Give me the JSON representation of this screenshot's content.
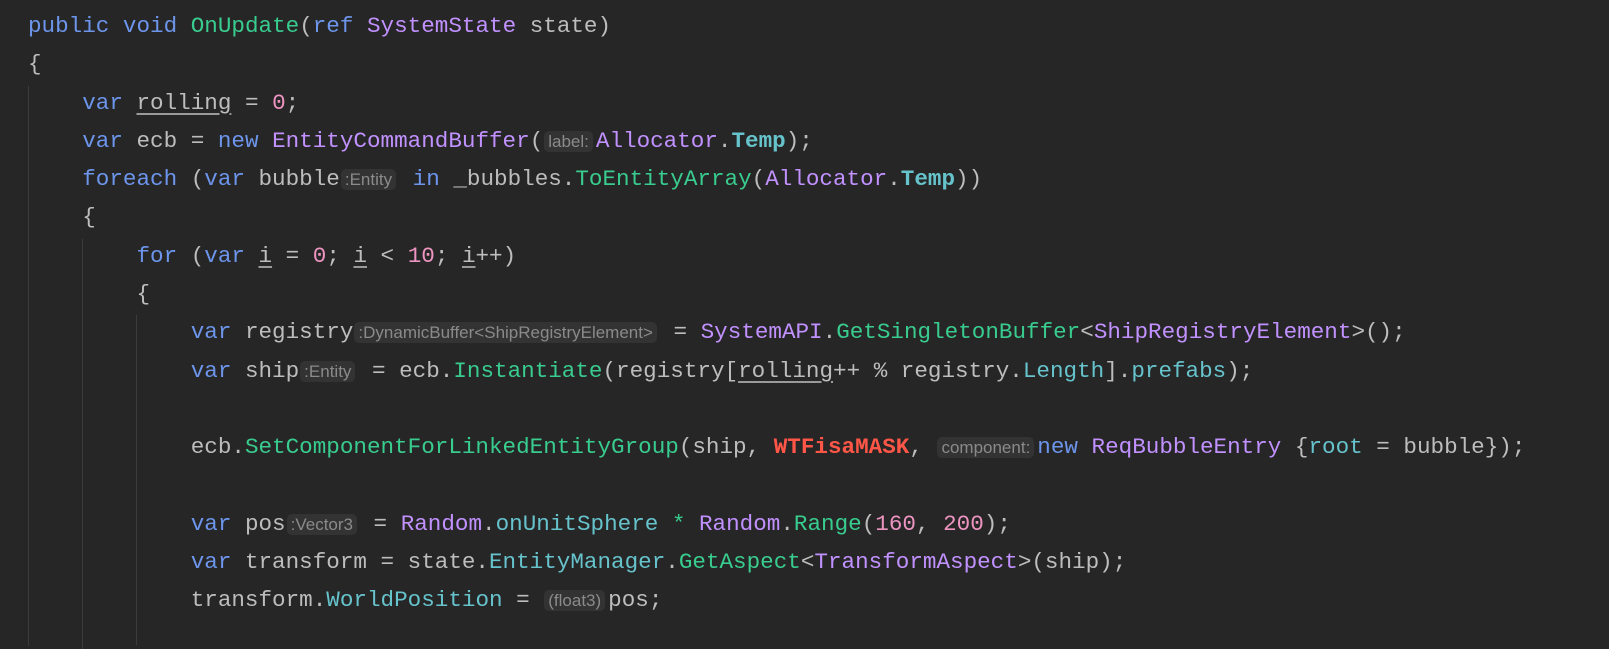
{
  "colors": {
    "background": "#262626",
    "keyword": "#6C95EB",
    "method": "#39CC8F",
    "type": "#C191FF",
    "number": "#ED94C0",
    "field": "#66C3CC",
    "error": "#FF5647",
    "text": "#BDBDBD"
  },
  "lines": [
    {
      "indent": 0,
      "tokens": [
        [
          "kw",
          "public "
        ],
        [
          "kw",
          "void "
        ],
        [
          "m",
          "OnUpdate"
        ],
        [
          "p",
          "("
        ],
        [
          "kw",
          "ref "
        ],
        [
          "t",
          "SystemState"
        ],
        [
          "p",
          " state)"
        ]
      ]
    },
    {
      "indent": 0,
      "tokens": [
        [
          "p",
          "{"
        ]
      ]
    },
    {
      "indent": 1,
      "tokens": [
        [
          "kw",
          "var "
        ],
        [
          "u",
          "rolling"
        ],
        [
          "p",
          " = "
        ],
        [
          "n",
          "0"
        ],
        [
          "p",
          ";"
        ]
      ]
    },
    {
      "indent": 1,
      "tokens": [
        [
          "kw",
          "var "
        ],
        [
          "p",
          "ecb = "
        ],
        [
          "kw",
          "new "
        ],
        [
          "t",
          "EntityCommandBuffer"
        ],
        [
          "p",
          "("
        ],
        [
          "h",
          "label:"
        ],
        [
          "t",
          "Allocator"
        ],
        [
          "p",
          "."
        ],
        [
          "fb",
          "Temp"
        ],
        [
          "p",
          ");"
        ]
      ]
    },
    {
      "indent": 1,
      "tokens": [
        [
          "kw",
          "foreach "
        ],
        [
          "p",
          "("
        ],
        [
          "kw",
          "var "
        ],
        [
          "p",
          "bubble"
        ],
        [
          "h",
          ":Entity"
        ],
        [
          "kw",
          " in "
        ],
        [
          "p",
          "_bubbles."
        ],
        [
          "m",
          "ToEntityArray"
        ],
        [
          "p",
          "("
        ],
        [
          "t",
          "Allocator"
        ],
        [
          "p",
          "."
        ],
        [
          "fb",
          "Temp"
        ],
        [
          "p",
          "))"
        ]
      ]
    },
    {
      "indent": 1,
      "tokens": [
        [
          "p",
          "{"
        ]
      ]
    },
    {
      "indent": 2,
      "tokens": [
        [
          "kw",
          "for "
        ],
        [
          "p",
          "("
        ],
        [
          "kw",
          "var "
        ],
        [
          "u",
          "i"
        ],
        [
          "p",
          " = "
        ],
        [
          "n",
          "0"
        ],
        [
          "p",
          "; "
        ],
        [
          "u",
          "i"
        ],
        [
          "p",
          " < "
        ],
        [
          "n",
          "10"
        ],
        [
          "p",
          "; "
        ],
        [
          "u",
          "i"
        ],
        [
          "p",
          "++)"
        ]
      ]
    },
    {
      "indent": 2,
      "tokens": [
        [
          "p",
          "{"
        ]
      ]
    },
    {
      "indent": 3,
      "tokens": [
        [
          "kw",
          "var "
        ],
        [
          "p",
          "registry"
        ],
        [
          "h",
          ":DynamicBuffer<ShipRegistryElement>"
        ],
        [
          "p",
          " = "
        ],
        [
          "t",
          "SystemAPI"
        ],
        [
          "p",
          "."
        ],
        [
          "m",
          "GetSingletonBuffer"
        ],
        [
          "p",
          "<"
        ],
        [
          "t",
          "ShipRegistryElement"
        ],
        [
          "p",
          ">();"
        ]
      ]
    },
    {
      "indent": 3,
      "tokens": [
        [
          "kw",
          "var "
        ],
        [
          "p",
          "ship"
        ],
        [
          "h",
          ":Entity"
        ],
        [
          "p",
          " = ecb."
        ],
        [
          "m",
          "Instantiate"
        ],
        [
          "p",
          "(registry["
        ],
        [
          "u",
          "rolling"
        ],
        [
          "p",
          "++ % registry."
        ],
        [
          "f",
          "Length"
        ],
        [
          "p",
          "]."
        ],
        [
          "f",
          "prefabs"
        ],
        [
          "p",
          ");"
        ]
      ]
    },
    {
      "indent": 3,
      "tokens": []
    },
    {
      "indent": 3,
      "tokens": [
        [
          "p",
          "ecb."
        ],
        [
          "m",
          "SetComponentForLinkedEntityGroup"
        ],
        [
          "p",
          "(ship, "
        ],
        [
          "r",
          "WTFisaMASK"
        ],
        [
          "p",
          ", "
        ],
        [
          "h",
          "component:"
        ],
        [
          "kw",
          "new "
        ],
        [
          "t",
          "ReqBubbleEntry"
        ],
        [
          "p",
          " {"
        ],
        [
          "f",
          "root"
        ],
        [
          "p",
          " = bubble});"
        ]
      ]
    },
    {
      "indent": 3,
      "tokens": []
    },
    {
      "indent": 3,
      "tokens": [
        [
          "kw",
          "var "
        ],
        [
          "p",
          "pos"
        ],
        [
          "h",
          ":Vector3"
        ],
        [
          "p",
          " = "
        ],
        [
          "t",
          "Random"
        ],
        [
          "p",
          "."
        ],
        [
          "f",
          "onUnitSphere"
        ],
        [
          "op",
          " * "
        ],
        [
          "t",
          "Random"
        ],
        [
          "p",
          "."
        ],
        [
          "m",
          "Range"
        ],
        [
          "p",
          "("
        ],
        [
          "n",
          "160"
        ],
        [
          "p",
          ", "
        ],
        [
          "n",
          "200"
        ],
        [
          "p",
          ");"
        ]
      ]
    },
    {
      "indent": 3,
      "tokens": [
        [
          "kw",
          "var "
        ],
        [
          "p",
          "transform = state."
        ],
        [
          "f",
          "EntityManager"
        ],
        [
          "p",
          "."
        ],
        [
          "m",
          "GetAspect"
        ],
        [
          "p",
          "<"
        ],
        [
          "t",
          "TransformAspect"
        ],
        [
          "p",
          ">(ship);"
        ]
      ]
    },
    {
      "indent": 3,
      "tokens": [
        [
          "p",
          "transform."
        ],
        [
          "f",
          "WorldPosition"
        ],
        [
          "p",
          " = "
        ],
        [
          "h",
          "(float3)"
        ],
        [
          "p",
          "pos;"
        ]
      ]
    }
  ]
}
